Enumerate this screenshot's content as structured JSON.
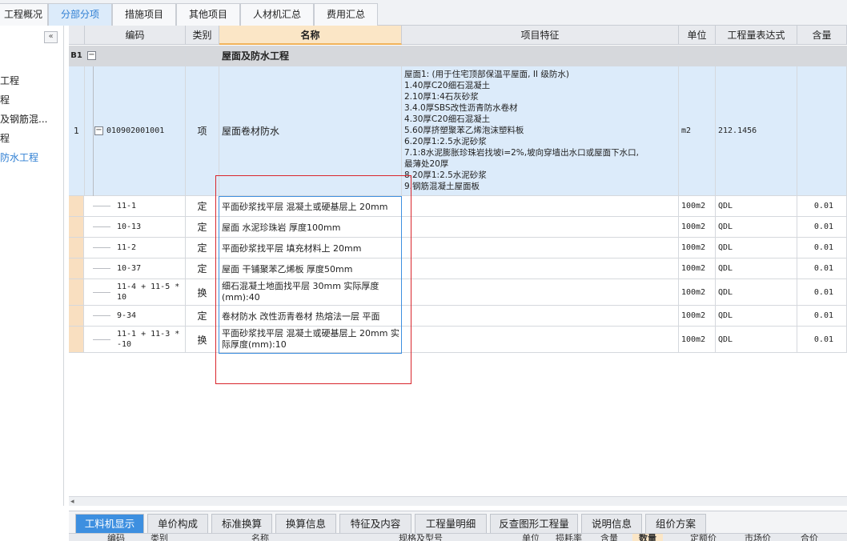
{
  "top_tabs": [
    {
      "label": "工程概况"
    },
    {
      "label": "分部分项"
    },
    {
      "label": "措施项目"
    },
    {
      "label": "其他项目"
    },
    {
      "label": "人材机汇总"
    },
    {
      "label": "费用汇总"
    }
  ],
  "left_panel": {
    "collapse_glyph": "«",
    "items": [
      "工程",
      "程",
      "及钢筋混...",
      "程",
      "防水工程"
    ]
  },
  "columns": [
    "编码",
    "类别",
    "名称",
    "项目特征",
    "单位",
    "工程量表达式",
    "含量"
  ],
  "group_row": {
    "marker": "B1",
    "name": "屋面及防水工程"
  },
  "main_row": {
    "index": "1",
    "code": "010902001001",
    "type": "项",
    "name": "屋面卷材防水",
    "features": "屋面1: (用于住宅顶部保温平屋面, II 级防水)\n1.40厚C20细石混凝土\n2.10厚1:4石灰砂浆\n3.4.0厚SBS改性沥青防水卷材\n4.30厚C20细石混凝土\n5.60厚挤塑聚苯乙烯泡沫塑料板\n6.20厚1:2.5水泥砂浆\n7.1:8水泥膨胀珍珠岩找坡i=2%,坡向穿墙出水口或屋面下水口,\n最薄处20厚\n8.20厚1:2.5水泥砂浆\n9.钢筋混凝土屋面板",
    "unit": "m2",
    "expr": "212.1456"
  },
  "sub_rows": [
    {
      "code": "11-1",
      "type": "定",
      "name": "平面砂浆找平层 混凝土或硬基层上 20mm",
      "unit": "100m2",
      "expr": "QDL",
      "qty": "0.01"
    },
    {
      "code": "10-13",
      "type": "定",
      "name": "屋面 水泥珍珠岩 厚度100mm",
      "unit": "100m2",
      "expr": "QDL",
      "qty": "0.01"
    },
    {
      "code": "11-2",
      "type": "定",
      "name": "平面砂浆找平层 填充材料上 20mm",
      "unit": "100m2",
      "expr": "QDL",
      "qty": "0.01"
    },
    {
      "code": "10-37",
      "type": "定",
      "name": "屋面 干铺聚苯乙烯板 厚度50mm",
      "unit": "100m2",
      "expr": "QDL",
      "qty": "0.01"
    },
    {
      "code": "11-4 + 11-5 * 10",
      "type": "换",
      "name": "细石混凝土地面找平层 30mm 实际厚度(mm):40",
      "unit": "100m2",
      "expr": "QDL",
      "qty": "0.01"
    },
    {
      "code": "9-34",
      "type": "定",
      "name": "卷材防水 改性沥青卷材 热熔法一层 平面",
      "unit": "100m2",
      "expr": "QDL",
      "qty": "0.01"
    },
    {
      "code": "11-1 + 11-3 * -10",
      "type": "换",
      "name": "平面砂浆找平层 混凝土或硬基层上 20mm 实际厚度(mm):10",
      "unit": "100m2",
      "expr": "QDL",
      "qty": "0.01"
    }
  ],
  "bottom_tabs": [
    "工料机显示",
    "单价构成",
    "标准换算",
    "换算信息",
    "特征及内容",
    "工程量明细",
    "反查图形工程量",
    "说明信息",
    "组价方案"
  ],
  "bottom_subheader": [
    "编码",
    "类别",
    "名称",
    "规格及型号",
    "单位",
    "损耗率",
    "含量",
    "数量",
    "定额价",
    "市场价",
    "合价"
  ],
  "colors": {
    "accent": "#3d8fe0",
    "selected_row": "#dcebfa",
    "highlight_red": "#d9262c"
  }
}
